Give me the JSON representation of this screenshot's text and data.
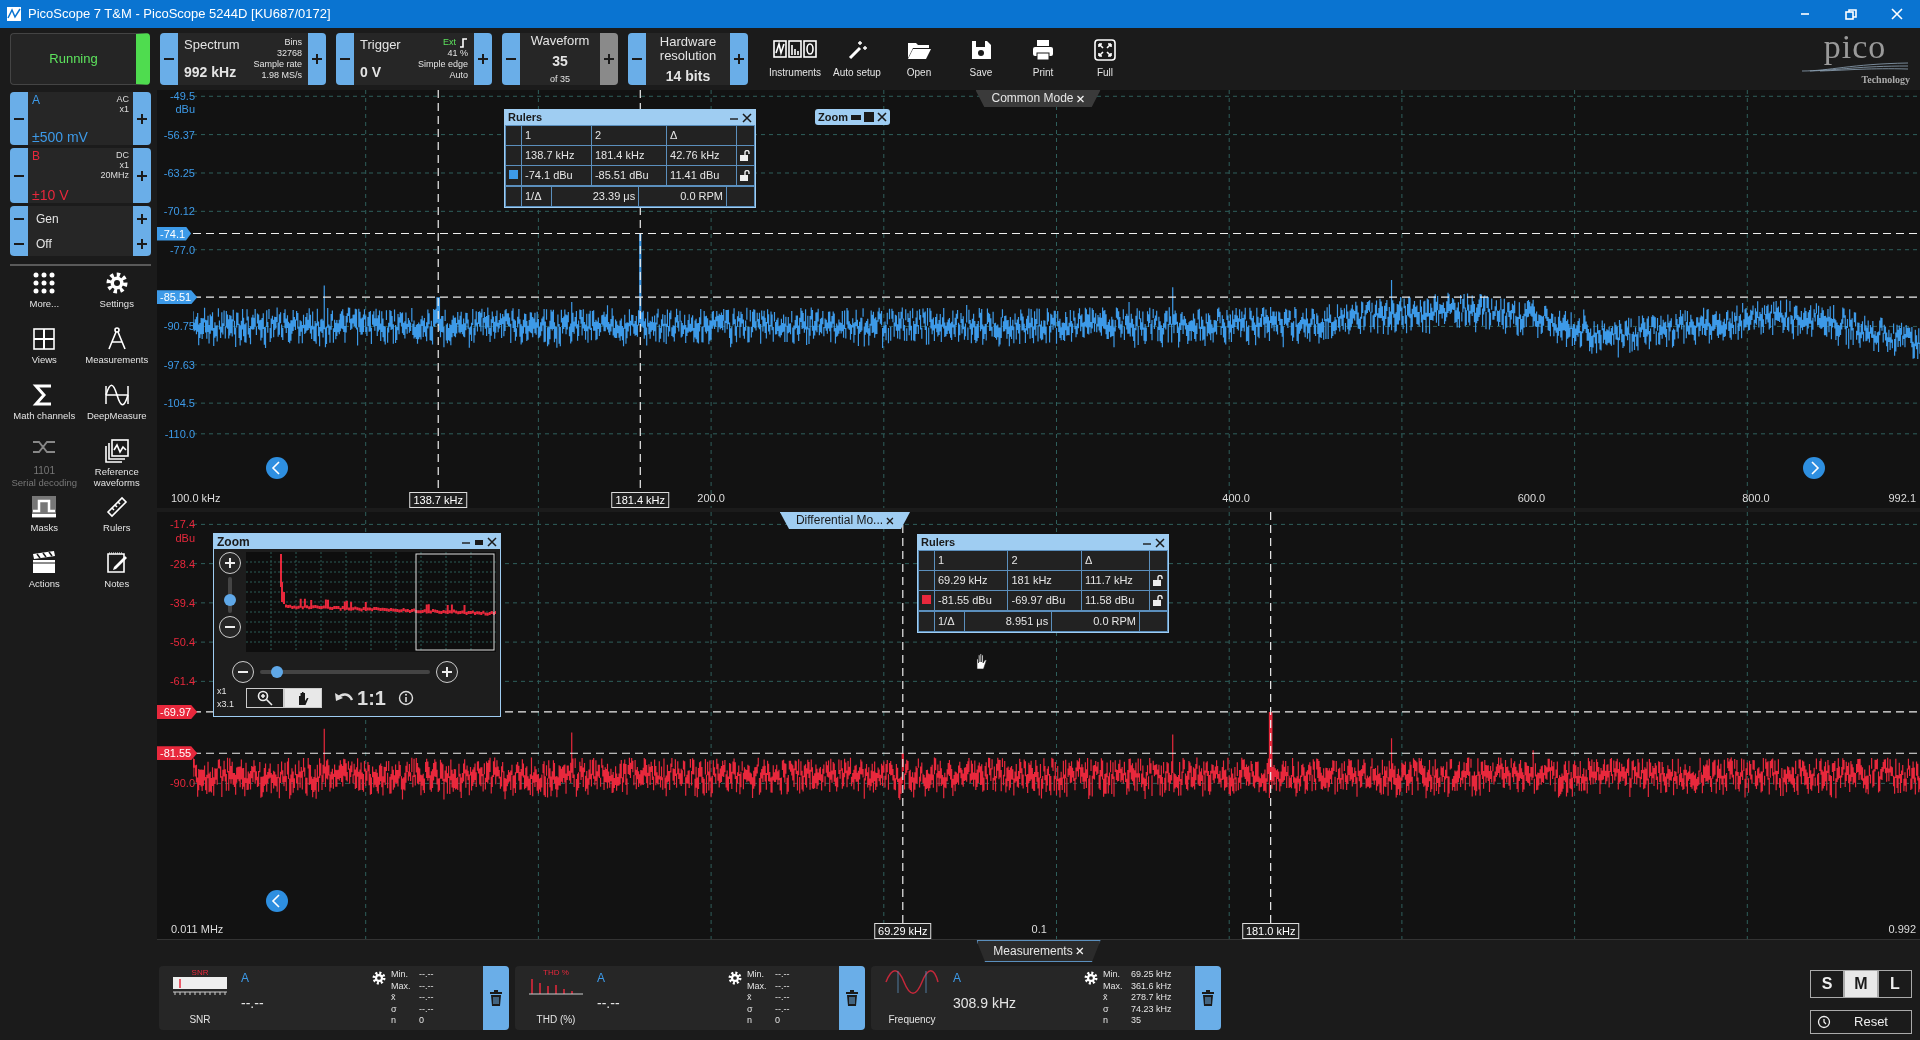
{
  "window": {
    "title": "PicoScope 7 T&M  - PicoScope 5244D [KU687/0172]"
  },
  "toolbar": {
    "run": {
      "label": "Running",
      "running": true
    },
    "controls": [
      {
        "kind": "spectrum",
        "title": "Spectrum",
        "value": "992 kHz",
        "info": [
          "Bins",
          "32768",
          "Sample rate",
          "1.98 MS/s"
        ],
        "plus_disabled": false
      },
      {
        "kind": "trigger",
        "title": "Trigger",
        "value": "0 V",
        "info": [
          "Ext",
          "41 %",
          "Simple edge",
          "Auto"
        ],
        "plus_disabled": false
      },
      {
        "kind": "waveform",
        "title": "Waveform",
        "value": "35",
        "sub": "of 35",
        "plus_disabled": true
      },
      {
        "kind": "resolution",
        "title": "Hardware resolution",
        "value": "14 bits",
        "plus_disabled": false
      }
    ],
    "tools": [
      "Instruments",
      "Auto setup",
      "Open",
      "Save",
      "Print",
      "Full"
    ],
    "logo": {
      "name": "pico",
      "tagline": "Technology"
    }
  },
  "channels": [
    {
      "name": "A",
      "info": [
        "AC",
        "x1"
      ],
      "range": "±500 mV",
      "color": "#3d9ae8"
    },
    {
      "name": "B",
      "info": [
        "DC",
        "x1",
        "20MHz"
      ],
      "range": "±10 V",
      "color": "#e8283c"
    }
  ],
  "generator": [
    "Gen",
    "Off"
  ],
  "sidebar_tools": [
    {
      "label": "More...",
      "disabled": false
    },
    {
      "label": "Settings",
      "disabled": false
    },
    {
      "label": "Views",
      "disabled": false
    },
    {
      "label": "Measurements",
      "disabled": false
    },
    {
      "label": "Math channels",
      "disabled": false
    },
    {
      "label": "DeepMeasure",
      "disabled": false
    },
    {
      "label": "Serial decoding",
      "disabled": true,
      "icon_text": "1101"
    },
    {
      "label": "Reference waveforms",
      "disabled": false
    },
    {
      "label": "Masks",
      "disabled": false
    },
    {
      "label": "Rulers",
      "disabled": false
    },
    {
      "label": "Actions",
      "disabled": false
    },
    {
      "label": "Notes",
      "disabled": false
    }
  ],
  "plots": [
    {
      "tab": "Common Mode",
      "selected": false,
      "color": "#3d9ae8",
      "y_unit": "dBu",
      "y_labels": [
        "-49.5",
        "-56.37",
        "-63.25",
        "-70.12",
        "-77.0",
        "-90.75",
        "-97.63",
        "-104.5",
        "-110.0"
      ],
      "x_labels": [
        "100.0 kHz",
        "200.0",
        "400.0",
        "600.0",
        "800.0",
        "992.1"
      ],
      "y_markers": [
        "-74.1",
        "-85.51"
      ],
      "x_markers": [
        "138.7 kHz",
        "181.4 kHz"
      ],
      "rulers": {
        "title": "Rulers",
        "columns": [
          "1",
          "2",
          "Δ"
        ],
        "rows": [
          [
            "138.7 kHz",
            "181.4 kHz",
            "42.76 kHz"
          ],
          [
            "-74.1 dBu",
            "-85.51 dBu",
            "11.41 dBu"
          ]
        ],
        "footer": [
          "1/Δ",
          "23.39 μs",
          "0.0 RPM"
        ]
      },
      "zoom": {
        "title": "Zoom",
        "expanded": false
      }
    },
    {
      "tab": "Differential Mo...",
      "selected": true,
      "color": "#e8283c",
      "y_unit": "dBu",
      "y_labels": [
        "-17.4",
        "-28.4",
        "-39.4",
        "-50.4",
        "-61.4",
        "-90.0"
      ],
      "x_labels": [
        "0.011 MHz",
        "0.1",
        "0.992"
      ],
      "y_markers": [
        "-69.97",
        "-81.55"
      ],
      "x_markers": [
        "69.29 kHz",
        "181.0 kHz"
      ],
      "rulers": {
        "title": "Rulers",
        "columns": [
          "1",
          "2",
          "Δ"
        ],
        "rows": [
          [
            "69.29 kHz",
            "181 kHz",
            "111.7 kHz"
          ],
          [
            "-81.55 dBu",
            "-69.97 dBu",
            "11.58 dBu"
          ]
        ],
        "footer": [
          "1/Δ",
          "8.951 μs",
          "0.0 RPM"
        ]
      },
      "zoom": {
        "title": "Zoom",
        "expanded": true,
        "scales": [
          "x1",
          "x3.1"
        ],
        "reset": "1:1",
        "vertical": {
          "level": 0.35
        },
        "horizontal": {
          "level": 0.1
        },
        "modes": [
          {
            "selected": false
          },
          {
            "selected": true
          }
        ]
      }
    }
  ],
  "measurements": {
    "tab": "Measurements",
    "cards": [
      {
        "kind": "snr",
        "icon_text": "SNR",
        "channel": "A",
        "label": "SNR",
        "value": "--.--",
        "stats": [
          {
            "label": "Min.",
            "value": "--.--"
          },
          {
            "label": "Max.",
            "value": "--.--"
          },
          {
            "label": "x̄",
            "value": "--.--"
          },
          {
            "label": "σ",
            "value": "--.--"
          },
          {
            "label": "n",
            "value": "0"
          }
        ]
      },
      {
        "kind": "thd",
        "icon_text": "THD %",
        "channel": "A",
        "label": "THD (%)",
        "value": "--.--",
        "stats": [
          {
            "label": "Min.",
            "value": "--.--"
          },
          {
            "label": "Max.",
            "value": "--.--"
          },
          {
            "label": "x̄",
            "value": "--.--"
          },
          {
            "label": "σ",
            "value": "--.--"
          },
          {
            "label": "n",
            "value": "0"
          }
        ]
      },
      {
        "kind": "frequency",
        "channel": "A",
        "label": "Frequency",
        "value": "308.9 kHz",
        "stats": [
          {
            "label": "Min.",
            "value": "69.25 kHz"
          },
          {
            "label": "Max.",
            "value": "361.6 kHz"
          },
          {
            "label": "x̄",
            "value": "278.7 kHz"
          },
          {
            "label": "σ",
            "value": "74.23 kHz"
          },
          {
            "label": "n",
            "value": "35"
          }
        ]
      }
    ],
    "sizes": [
      {
        "label": "S",
        "selected": false
      },
      {
        "label": "M",
        "selected": true
      },
      {
        "label": "L",
        "selected": false
      }
    ],
    "reset": "Reset"
  }
}
